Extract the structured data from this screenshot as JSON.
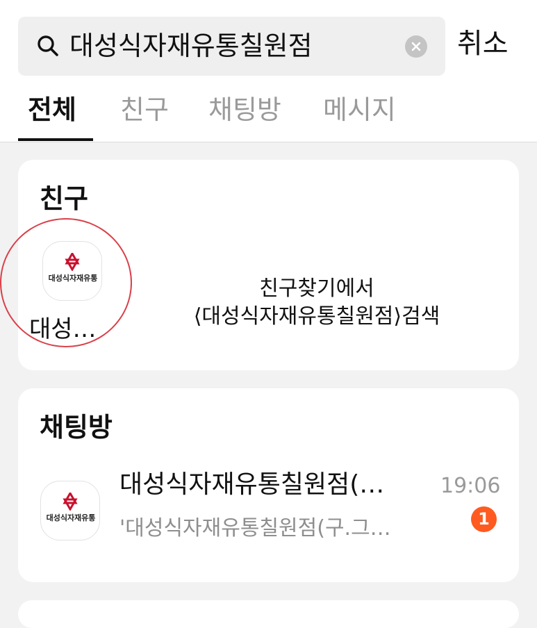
{
  "search": {
    "query": "대성식자재유통칠원점",
    "cancel_label": "취소"
  },
  "tabs": [
    {
      "label": "전체",
      "active": true
    },
    {
      "label": "친구",
      "active": false
    },
    {
      "label": "채팅방",
      "active": false
    },
    {
      "label": "메시지",
      "active": false
    }
  ],
  "friends_section": {
    "title": "친구",
    "items": [
      {
        "name": "대성…",
        "logo_text": "대성식자재유통",
        "logo_icon": "red-star-logo-icon"
      }
    ],
    "find_hint_line1": "친구찾기에서",
    "find_hint_line2": "⟨대성식자재유통칠원점⟩검색"
  },
  "chats_section": {
    "title": "채팅방",
    "items": [
      {
        "title": "대성식자재유통칠원점(…",
        "preview": "'대성식자재유통칠원점(구.그…",
        "time": "19:06",
        "unread": "1",
        "logo_text": "대성식자재유통",
        "logo_icon": "red-star-logo-icon"
      }
    ]
  },
  "colors": {
    "highlight_circle": "#d9404a",
    "badge": "#ff5a1f",
    "logo_star": "#c8102e"
  }
}
